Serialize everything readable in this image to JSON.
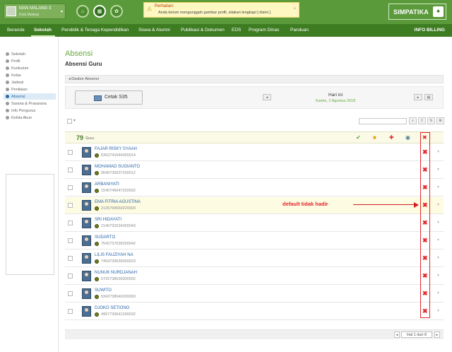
{
  "header": {
    "school_name": "MAN MALANG 3",
    "school_city": "Kota Malang",
    "alert_title": "Perhatian:",
    "alert_text": "Anda belum mengunggah gambar profil, silakan lengkapi [ disini ]",
    "brand": "SIMPATIKA"
  },
  "nav": {
    "items": [
      "Beranda",
      "Sekolah",
      "Pendidik & Tenaga Kependidikan",
      "Siswa & Alumni",
      "Publikasi & Dokumen",
      "EDS",
      "Program Dinas",
      "Panduan"
    ],
    "active": "Sekolah",
    "right": "INFO BILLING"
  },
  "sidebar": {
    "items": [
      "Sekolah",
      "Profil",
      "Kurikulum",
      "Kelas",
      "Jadwal",
      "Penilaian",
      "Absensi",
      "Sarana & Prasarana",
      "Info Pengurus",
      "Kelola Akun"
    ],
    "active": "Absensi"
  },
  "main": {
    "title": "Absensi",
    "subtitle": "Absensi Guru",
    "breadcrumb": "Dasbor Absensi",
    "print_label": "Cetak S35",
    "day_title": "Hari ini",
    "day_date": "Kamis, 2 Agustus 2018",
    "count": "79",
    "count_label": "Guru"
  },
  "legend": {
    "present": "✔",
    "leave": "■",
    "sick": "✚",
    "other": "◉",
    "absent": "✖"
  },
  "teachers": [
    {
      "name": "FAJAR RISKY SYAAH",
      "nip": "6363741644300014"
    },
    {
      "name": "MOHAMAD SUGIANTO",
      "nip": "9549735637200012"
    },
    {
      "name": "ARBANIYATI",
      "nip": "1540746647220002"
    },
    {
      "name": "EMA FITRIA AGUSTINA",
      "nip": "2135758659220003"
    },
    {
      "name": "SRI HIDAYATI",
      "nip": "2140732634300043"
    },
    {
      "name": "SUDARTO",
      "nip": "7542737639200042"
    },
    {
      "name": "LILIS FAUZIYAH NA",
      "nip": "7454739639300023"
    },
    {
      "name": "NUNUK NURDJANAH",
      "nip": "5792738639300002"
    },
    {
      "name": "SUWITO",
      "nip": "5342738640200093"
    },
    {
      "name": "DJOKO SETIONO",
      "nip": "4957739641290032"
    }
  ],
  "annotation": "default tidak hadir",
  "pager": "Hal 1 dari 8"
}
